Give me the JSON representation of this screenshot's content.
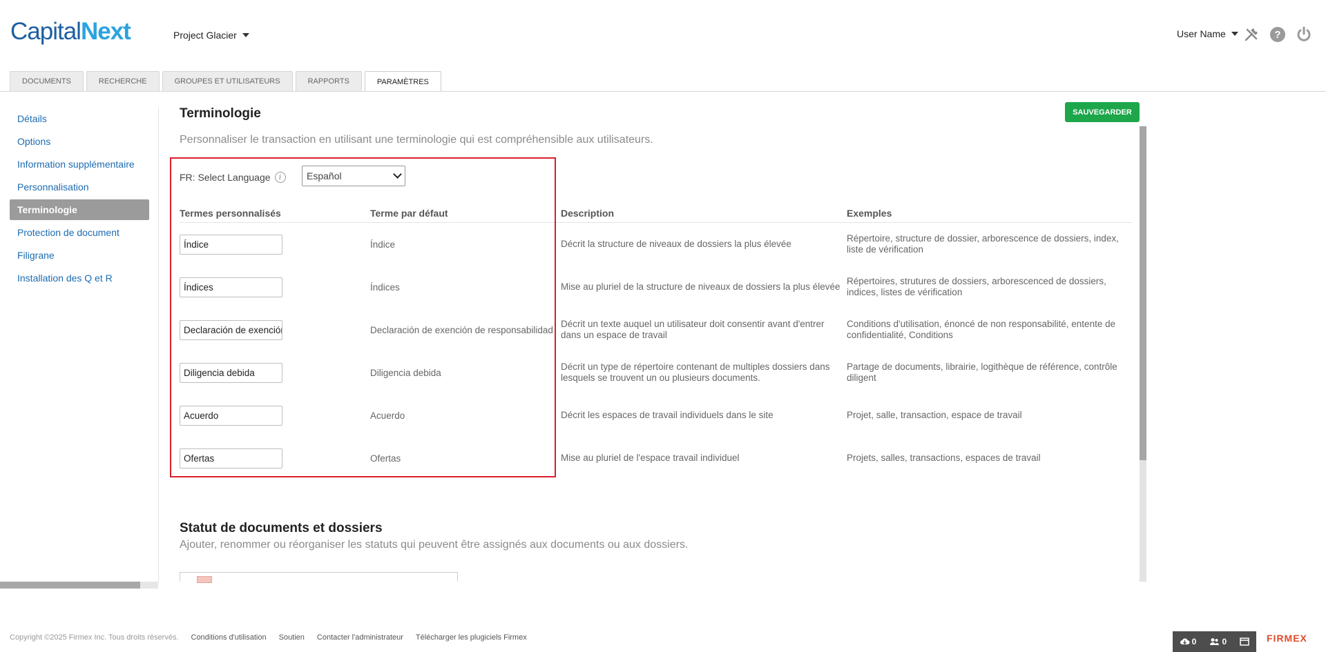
{
  "logo": {
    "capital": "Capital",
    "next": "Next"
  },
  "project": {
    "label": "Project Glacier"
  },
  "user": {
    "label": "User Name"
  },
  "icons": {
    "tools": "tools-icon",
    "help": "help-icon",
    "power": "power-icon"
  },
  "tabs": [
    {
      "label": "DOCUMENTS"
    },
    {
      "label": "RECHERCHE"
    },
    {
      "label": "GROUPES ET UTILISATEURS"
    },
    {
      "label": "RAPPORTS"
    },
    {
      "label": "PARAMÈTRES",
      "active": true
    }
  ],
  "sidebar": {
    "items": [
      {
        "label": "Détails"
      },
      {
        "label": "Options"
      },
      {
        "label": "Information supplémentaire"
      },
      {
        "label": "Personnalisation"
      },
      {
        "label": "Terminologie",
        "active": true
      },
      {
        "label": "Protection de document"
      },
      {
        "label": "Filigrane"
      },
      {
        "label": "Installation des Q et R"
      }
    ]
  },
  "main": {
    "title": "Terminologie",
    "save_label": "SAUVEGARDER",
    "subtitle": "Personnaliser le transaction en utilisant une terminologie qui est compréhensible aux utilisateurs.",
    "language": {
      "label": "FR: Select Language",
      "info": "i",
      "selected": "Español"
    },
    "table": {
      "headers": [
        "Termes personnalisés",
        "Terme par défaut",
        "Description",
        "Exemples"
      ],
      "rows": [
        {
          "custom": "Índice",
          "default": "Índice",
          "description": "Décrit la structure de niveaux de dossiers la plus élevée",
          "examples": "Répertoire, structure de dossier, arborescence de dossiers, index, liste de vérification"
        },
        {
          "custom": "Índices",
          "default": "Índices",
          "description": "Mise au pluriel de la structure de niveaux de dossiers la plus élevée",
          "examples": "Répertoires, strutures de dossiers, arborescenced de dossiers, indices, listes de vérification"
        },
        {
          "custom": "Declaración de exención",
          "default": "Declaración de exención de responsabilidad",
          "description": "Décrit un texte auquel un utilisateur doit consentir avant d'entrer dans un espace de travail",
          "examples": "Conditions d'utilisation, énoncé de non responsabilité, entente de confidentialité, Conditions"
        },
        {
          "custom": "Diligencia debida",
          "default": "Diligencia debida",
          "description": "Décrit un type de répertoire contenant de multiples dossiers dans lesquels se trouvent un ou plusieurs documents.",
          "examples": "Partage de documents, librairie, logithèque de référence, contrôle diligent"
        },
        {
          "custom": "Acuerdo",
          "default": "Acuerdo",
          "description": "Décrit les espaces de travail individuels dans le site",
          "examples": "Projet, salle, transaction, espace de travail"
        },
        {
          "custom": "Ofertas",
          "default": "Ofertas",
          "description": "Mise au pluriel de l'espace travail individuel",
          "examples": "Projets, salles, transactions, espaces de travail"
        }
      ]
    },
    "status_title": "Statut de documents et dossiers",
    "status_subtitle": "Ajouter, renommer ou réorganiser les statuts qui peuvent être assignés aux documents ou aux dossiers."
  },
  "footer": {
    "copyright": "Copyright ©2025 Firmex Inc. Tous droits réservés.",
    "links": [
      "Conditions d'utilisation",
      "Soutien",
      "Contacter l'administrateur",
      "Télécharger les plugiciels Firmex"
    ]
  },
  "counters": {
    "downloads": "0",
    "users": "0"
  },
  "brand": {
    "firmex": "FIRMEX"
  },
  "colors": {
    "accent": "#1da64a",
    "link": "#1b6bb0",
    "highlight": "#d81e2a",
    "brand": "#e04b2a"
  }
}
